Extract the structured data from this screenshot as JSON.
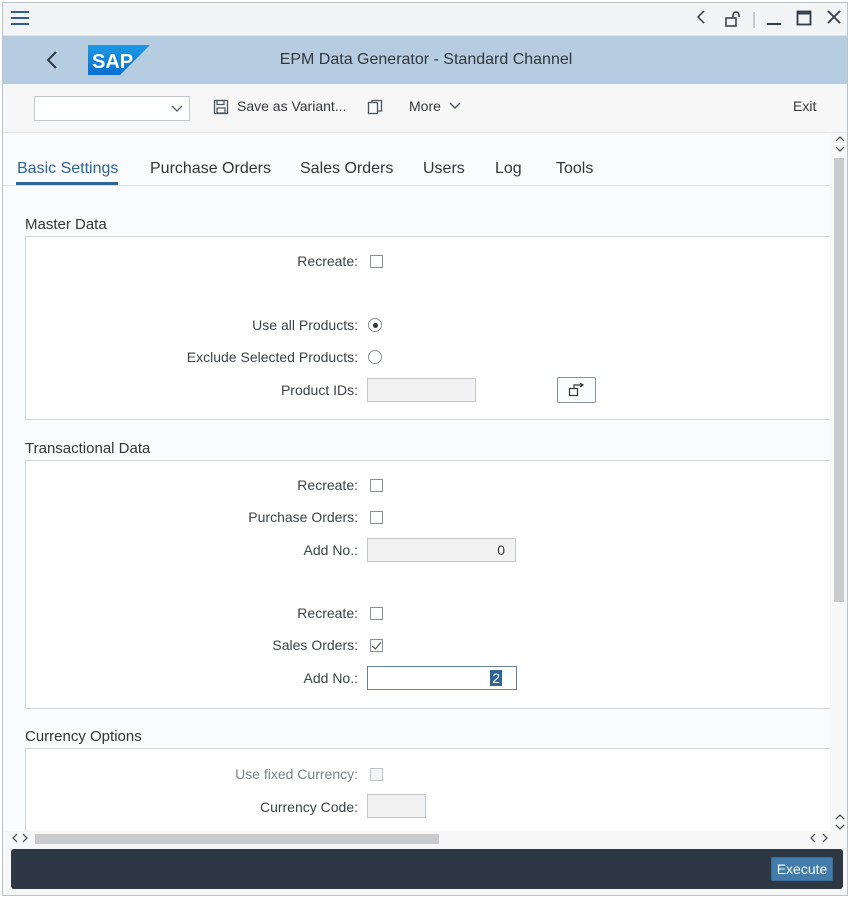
{
  "shell": {
    "title": "EPM Data Generator - Standard Channel",
    "logo": "SAP"
  },
  "toolbar": {
    "variant_value": "",
    "save_variant": "Save as Variant...",
    "more": "More",
    "exit": "Exit"
  },
  "tabs": [
    "Basic Settings",
    "Purchase Orders",
    "Sales Orders",
    "Users",
    "Log",
    "Tools"
  ],
  "master_data": {
    "title": "Master Data",
    "recreate_label": "Recreate:",
    "recreate_checked": false,
    "use_all_label": "Use all Products:",
    "use_all_selected": true,
    "exclude_label": "Exclude Selected Products:",
    "exclude_selected": false,
    "product_ids_label": "Product IDs:",
    "product_ids_value": ""
  },
  "transactional_data": {
    "title": "Transactional Data",
    "po_recreate_label": "Recreate:",
    "po_recreate_checked": false,
    "po_label": "Purchase Orders:",
    "po_checked": false,
    "po_add_label": "Add No.:",
    "po_add_value": "0",
    "so_recreate_label": "Recreate:",
    "so_recreate_checked": false,
    "so_label": "Sales Orders:",
    "so_checked": true,
    "so_add_label": "Add No.:",
    "so_add_value": "2"
  },
  "currency_options": {
    "title": "Currency Options",
    "fixed_label": "Use fixed Currency:",
    "fixed_checked": false,
    "code_label": "Currency Code:",
    "code_value": ""
  },
  "footer": {
    "execute": "Execute"
  },
  "colors": {
    "shell_bg": "#b6cde1",
    "accent": "#2f6497",
    "footer_bg": "#2d3844",
    "execute_bg": "#427cac"
  }
}
